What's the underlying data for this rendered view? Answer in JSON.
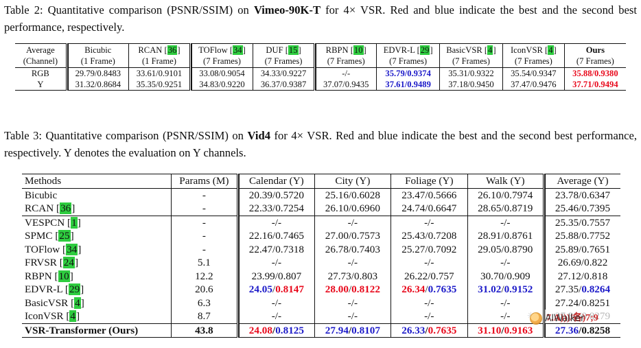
{
  "table2": {
    "caption_prefix": "Table 2:  Quantitative comparison (PSNR/SSIM) on ",
    "caption_dataset": "Vimeo-90K-T",
    "caption_suffix": " for 4× VSR. Red and blue indicate the best and the second best performance, respectively.",
    "columns": [
      {
        "name": "Average",
        "sub": "(Channel)",
        "cite": "",
        "bold": false
      },
      {
        "name": "Bicubic",
        "sub": "(1 Frame)",
        "cite": "",
        "bold": false
      },
      {
        "name": "RCAN",
        "sub": "(1 Frame)",
        "cite": "36",
        "bold": false
      },
      {
        "name": "TOFlow",
        "sub": "(7 Frames)",
        "cite": "34",
        "bold": false
      },
      {
        "name": "DUF",
        "sub": "(7 Frames)",
        "cite": "15",
        "bold": false
      },
      {
        "name": "RBPN",
        "sub": "(7 Frames)",
        "cite": "10",
        "bold": false
      },
      {
        "name": "EDVR-L",
        "sub": "(7 Frames)",
        "cite": "29",
        "bold": false
      },
      {
        "name": "BasicVSR",
        "sub": "(7 Frames)",
        "cite": "4",
        "bold": false
      },
      {
        "name": "IconVSR",
        "sub": "(7 Frames)",
        "cite": "4",
        "bold": false
      },
      {
        "name": "Ours",
        "sub": "(7 Frames)",
        "cite": "",
        "bold": true
      }
    ],
    "rows": [
      {
        "channel": "RGB",
        "cells": [
          {
            "text": "29.79/0.8483",
            "color": "none"
          },
          {
            "text": "33.61/0.9101",
            "color": "none"
          },
          {
            "text": "33.08/0.9054",
            "color": "none"
          },
          {
            "text": "34.33/0.9227",
            "color": "none"
          },
          {
            "text": "-/-",
            "color": "none"
          },
          {
            "text": "35.79/0.9374",
            "color": "blue"
          },
          {
            "text": "35.31/0.9322",
            "color": "none"
          },
          {
            "text": "35.54/0.9347",
            "color": "none"
          },
          {
            "text": "35.88/0.9380",
            "color": "red"
          }
        ]
      },
      {
        "channel": "Y",
        "cells": [
          {
            "text": "31.32/0.8684",
            "color": "none"
          },
          {
            "text": "35.35/0.9251",
            "color": "none"
          },
          {
            "text": "34.83/0.9220",
            "color": "none"
          },
          {
            "text": "36.37/0.9387",
            "color": "none"
          },
          {
            "text": "37.07/0.9435",
            "color": "none"
          },
          {
            "text": "37.61/0.9489",
            "color": "blue"
          },
          {
            "text": "37.18/0.9450",
            "color": "none"
          },
          {
            "text": "37.47/0.9476",
            "color": "none"
          },
          {
            "text": "37.71/0.9494",
            "color": "red"
          }
        ]
      }
    ]
  },
  "table3": {
    "caption_prefix": "Table 3: Quantitative comparison (PSNR/SSIM) on ",
    "caption_dataset": "Vid4",
    "caption_suffix": " for 4× VSR. Red and blue indicate the best and the second best performance, respectively. Y denotes the evaluation on Y channels.",
    "columns": [
      "Methods",
      "Params (M)",
      "Calendar (Y)",
      "City (Y)",
      "Foliage (Y)",
      "Walk (Y)",
      "Average (Y)"
    ],
    "rows": [
      {
        "method": "Bicubic",
        "cite": "",
        "bold": false,
        "params": "-",
        "cells": [
          {
            "psnr": "20.39",
            "psnr_color": "none",
            "ssim": "0.5720",
            "ssim_color": "none"
          },
          {
            "psnr": "25.16",
            "psnr_color": "none",
            "ssim": "0.6028",
            "ssim_color": "none"
          },
          {
            "psnr": "23.47",
            "psnr_color": "none",
            "ssim": "0.5666",
            "ssim_color": "none"
          },
          {
            "psnr": "26.10",
            "psnr_color": "none",
            "ssim": "0.7974",
            "ssim_color": "none"
          },
          {
            "psnr": "23.78",
            "psnr_color": "none",
            "ssim": "0.6347",
            "ssim_color": "none"
          }
        ]
      },
      {
        "method": "RCAN",
        "cite": "36",
        "bold": false,
        "params": "-",
        "rule_below": true,
        "cells": [
          {
            "psnr": "22.33",
            "psnr_color": "none",
            "ssim": "0.7254",
            "ssim_color": "none"
          },
          {
            "psnr": "26.10",
            "psnr_color": "none",
            "ssim": "0.6960",
            "ssim_color": "none"
          },
          {
            "psnr": "24.74",
            "psnr_color": "none",
            "ssim": "0.6647",
            "ssim_color": "none"
          },
          {
            "psnr": "28.65",
            "psnr_color": "none",
            "ssim": "0.8719",
            "ssim_color": "none"
          },
          {
            "psnr": "25.46",
            "psnr_color": "none",
            "ssim": "0.7395",
            "ssim_color": "none"
          }
        ]
      },
      {
        "method": "VESPCN",
        "cite": "1",
        "bold": false,
        "params": "-",
        "cells": [
          {
            "dash": "-/-"
          },
          {
            "dash": "-/-"
          },
          {
            "dash": "-/-"
          },
          {
            "dash": "-/-"
          },
          {
            "psnr": "25.35",
            "psnr_color": "none",
            "ssim": "0.7557",
            "ssim_color": "none"
          }
        ]
      },
      {
        "method": "SPMC",
        "cite": "25",
        "bold": false,
        "params": "-",
        "cells": [
          {
            "psnr": "22.16",
            "psnr_color": "none",
            "ssim": "0.7465",
            "ssim_color": "none"
          },
          {
            "psnr": "27.00",
            "psnr_color": "none",
            "ssim": "0.7573",
            "ssim_color": "none"
          },
          {
            "psnr": "25.43",
            "psnr_color": "none",
            "ssim": "0.7208",
            "ssim_color": "none"
          },
          {
            "psnr": "28.91",
            "psnr_color": "none",
            "ssim": "0.8761",
            "ssim_color": "none"
          },
          {
            "psnr": "25.88",
            "psnr_color": "none",
            "ssim": "0.7752",
            "ssim_color": "none"
          }
        ]
      },
      {
        "method": "TOFlow",
        "cite": "34",
        "bold": false,
        "params": "-",
        "cells": [
          {
            "psnr": "22.47",
            "psnr_color": "none",
            "ssim": "0.7318",
            "ssim_color": "none"
          },
          {
            "psnr": "26.78",
            "psnr_color": "none",
            "ssim": "0.7403",
            "ssim_color": "none"
          },
          {
            "psnr": "25.27",
            "psnr_color": "none",
            "ssim": "0.7092",
            "ssim_color": "none"
          },
          {
            "psnr": "29.05",
            "psnr_color": "none",
            "ssim": "0.8790",
            "ssim_color": "none"
          },
          {
            "psnr": "25.89",
            "psnr_color": "none",
            "ssim": "0.7651",
            "ssim_color": "none"
          }
        ]
      },
      {
        "method": "FRVSR",
        "cite": "24",
        "bold": false,
        "params": "5.1",
        "cells": [
          {
            "dash": "-/-"
          },
          {
            "dash": "-/-"
          },
          {
            "dash": "-/-"
          },
          {
            "dash": "-/-"
          },
          {
            "psnr": "26.69",
            "psnr_color": "none",
            "ssim": "0.822",
            "ssim_color": "none"
          }
        ]
      },
      {
        "method": "RBPN",
        "cite": "10",
        "bold": false,
        "params": "12.2",
        "cells": [
          {
            "psnr": "23.99",
            "psnr_color": "none",
            "ssim": "0.807",
            "ssim_color": "none"
          },
          {
            "psnr": "27.73",
            "psnr_color": "none",
            "ssim": "0.803",
            "ssim_color": "none"
          },
          {
            "psnr": "26.22",
            "psnr_color": "none",
            "ssim": "0.757",
            "ssim_color": "none"
          },
          {
            "psnr": "30.70",
            "psnr_color": "none",
            "ssim": "0.909",
            "ssim_color": "none"
          },
          {
            "psnr": "27.12",
            "psnr_color": "none",
            "ssim": "0.818",
            "ssim_color": "none"
          }
        ]
      },
      {
        "method": "EDVR-L",
        "cite": "29",
        "bold": false,
        "params": "20.6",
        "cells": [
          {
            "psnr": "24.05",
            "psnr_color": "blue",
            "ssim": "0.8147",
            "ssim_color": "red"
          },
          {
            "psnr": "28.00",
            "psnr_color": "red",
            "ssim": "0.8122",
            "ssim_color": "red"
          },
          {
            "psnr": "26.34",
            "psnr_color": "red",
            "ssim": "0.7635",
            "ssim_color": "blue"
          },
          {
            "psnr": "31.02",
            "psnr_color": "blue",
            "ssim": "0.9152",
            "ssim_color": "blue"
          },
          {
            "psnr": "27.35",
            "psnr_color": "none",
            "ssim": "0.8264",
            "ssim_color": "blue"
          }
        ]
      },
      {
        "method": "BasicVSR",
        "cite": "4",
        "bold": false,
        "params": "6.3",
        "cells": [
          {
            "dash": "-/-"
          },
          {
            "dash": "-/-"
          },
          {
            "dash": "-/-"
          },
          {
            "dash": "-/-"
          },
          {
            "psnr": "27.24",
            "psnr_color": "none",
            "ssim": "0.8251",
            "ssim_color": "none"
          }
        ]
      },
      {
        "method": "IconVSR",
        "cite": "4",
        "bold": false,
        "params": "8.7",
        "watermarked_cell": 4,
        "cells": [
          {
            "dash": "-/-"
          },
          {
            "dash": "-/-"
          },
          {
            "dash": "-/-"
          },
          {
            "dash": "-/-"
          },
          {
            "psnr": "27.39",
            "psnr_color": "none",
            "ssim": "0.8279",
            "ssim_color": "none"
          }
        ]
      },
      {
        "method": "VSR-Transformer (Ours)",
        "cite": "",
        "bold": true,
        "params": "43.8",
        "ours": true,
        "cells": [
          {
            "psnr": "24.08",
            "psnr_color": "red",
            "ssim": "0.8125",
            "ssim_color": "blue"
          },
          {
            "psnr": "27.94",
            "psnr_color": "blue",
            "ssim": "0.8107",
            "ssim_color": "blue"
          },
          {
            "psnr": "26.33",
            "psnr_color": "blue",
            "ssim": "0.7635",
            "ssim_color": "red"
          },
          {
            "psnr": "31.10",
            "psnr_color": "red",
            "ssim": "0.9163",
            "ssim_color": "red"
          },
          {
            "psnr": "27.36",
            "psnr_color": "blue",
            "ssim": "0.8258",
            "ssim_color": "none"
          }
        ]
      }
    ]
  },
  "watermark": {
    "text": "AIWalker",
    "overlay": "7.A)))/各)7;9"
  },
  "colors": {
    "best_red": "#e8071a",
    "second_blue": "#1b19c8",
    "citation_highlight": "#2ecc3f"
  }
}
